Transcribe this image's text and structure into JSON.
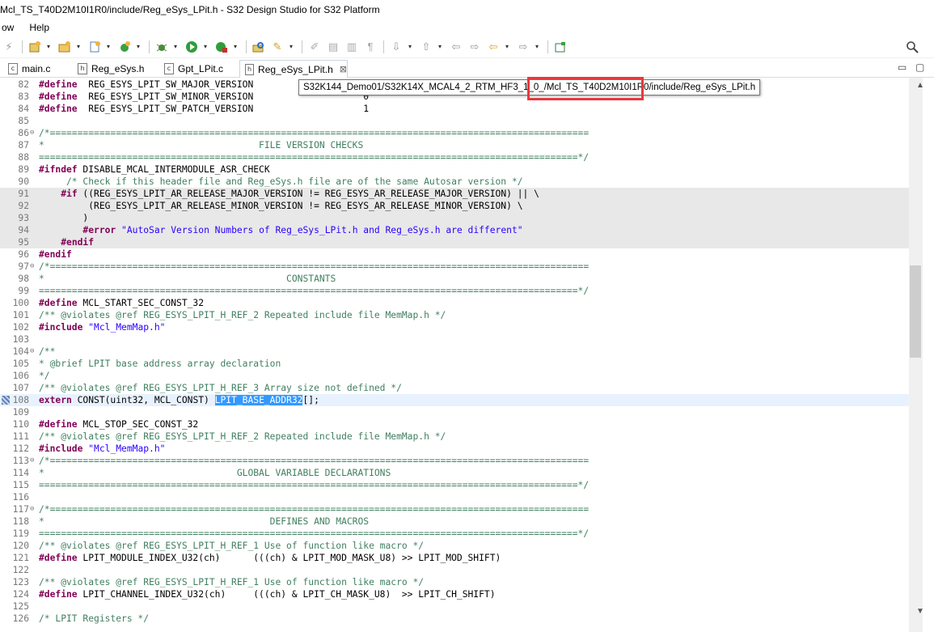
{
  "window": {
    "title": "Mcl_TS_T40D2M10I1R0/include/Reg_eSys_LPit.h - S32 Design Studio for S32 Platform"
  },
  "menu": [
    "ow",
    "Help"
  ],
  "tabs": [
    {
      "label": "main.c",
      "icon": "c-file-icon"
    },
    {
      "label": "Reg_eSys.h",
      "icon": "h-file-icon"
    },
    {
      "label": "Gpt_LPit.c",
      "icon": "c-file-icon"
    },
    {
      "label": "Reg_eSys_LPit.h",
      "icon": "h-file-icon",
      "active": true,
      "close": "⊠"
    }
  ],
  "window_controls": {
    "minimize": "▭",
    "maximize": "▢"
  },
  "tooltip": {
    "text": "S32K144_Demo01/S32K14X_MCAL4_2_RTM_HF3_1_0_/Mcl_TS_T40D2M10I1R0/include/Reg_eSys_LPit.h",
    "highlight_color": "#e8383d"
  },
  "colors": {
    "keyword": "#7f0055",
    "comment": "#3f7f5f",
    "string": "#2a00ff",
    "selection": "#3399ff"
  },
  "code": [
    {
      "n": "82",
      "parts": [
        [
          "kw",
          "#define"
        ],
        [
          "",
          "  REG_ESYS_LPIT_SW_MAJOR_VERSION"
        ]
      ]
    },
    {
      "n": "83",
      "parts": [
        [
          "kw",
          "#define"
        ],
        [
          "",
          "  REG_ESYS_LPIT_SW_MINOR_VERSION                    0"
        ]
      ]
    },
    {
      "n": "84",
      "parts": [
        [
          "kw",
          "#define"
        ],
        [
          "",
          "  REG_ESYS_LPIT_SW_PATCH_VERSION                    1"
        ]
      ]
    },
    {
      "n": "85",
      "parts": []
    },
    {
      "n": "86",
      "fold": "⊖",
      "parts": [
        [
          "cm",
          "/*=================================================================================================="
        ]
      ]
    },
    {
      "n": "87",
      "parts": [
        [
          "cm",
          "*                                       FILE VERSION CHECKS"
        ]
      ]
    },
    {
      "n": "88",
      "parts": [
        [
          "cm",
          "==================================================================================================*/"
        ]
      ]
    },
    {
      "n": "89",
      "parts": [
        [
          "kw",
          "#ifndef"
        ],
        [
          "",
          " DISABLE_MCAL_INTERMODULE_ASR_CHECK"
        ]
      ]
    },
    {
      "n": "90",
      "parts": [
        [
          "cm",
          "     /* Check if this header file and Reg_eSys.h file are of the same Autosar version */"
        ]
      ]
    },
    {
      "n": "91",
      "grey": true,
      "parts": [
        [
          "",
          "    "
        ],
        [
          "kw",
          "#if"
        ],
        [
          "",
          " ((REG_ESYS_LPIT_AR_RELEASE_MAJOR_VERSION != REG_ESYS_AR_RELEASE_MAJOR_VERSION) || \\"
        ]
      ]
    },
    {
      "n": "92",
      "grey": true,
      "parts": [
        [
          "",
          "         (REG_ESYS_LPIT_AR_RELEASE_MINOR_VERSION != REG_ESYS_AR_RELEASE_MINOR_VERSION) \\"
        ]
      ]
    },
    {
      "n": "93",
      "grey": true,
      "parts": [
        [
          "",
          "        )"
        ]
      ]
    },
    {
      "n": "94",
      "grey": true,
      "parts": [
        [
          "",
          "        "
        ],
        [
          "kw",
          "#error"
        ],
        [
          "",
          " "
        ],
        [
          "str",
          "\"AutoSar Version Numbers of Reg_eSys_LPit.h and Reg_eSys.h are different\""
        ]
      ]
    },
    {
      "n": "95",
      "grey": true,
      "parts": [
        [
          "",
          "    "
        ],
        [
          "kw",
          "#endif"
        ]
      ]
    },
    {
      "n": "96",
      "parts": [
        [
          "kw",
          "#endif"
        ]
      ]
    },
    {
      "n": "97",
      "fold": "⊖",
      "parts": [
        [
          "cm",
          "/*=================================================================================================="
        ]
      ]
    },
    {
      "n": "98",
      "parts": [
        [
          "cm",
          "*                                            CONSTANTS"
        ]
      ]
    },
    {
      "n": "99",
      "parts": [
        [
          "cm",
          "==================================================================================================*/"
        ]
      ]
    },
    {
      "n": "100",
      "parts": [
        [
          "kw",
          "#define"
        ],
        [
          "",
          " MCL_START_SEC_CONST_32"
        ]
      ]
    },
    {
      "n": "101",
      "parts": [
        [
          "cm",
          "/** @violates @ref REG_ESYS_LPIT_H_REF_2 Repeated include file MemMap.h */"
        ]
      ]
    },
    {
      "n": "102",
      "parts": [
        [
          "kw",
          "#include"
        ],
        [
          "",
          " "
        ],
        [
          "str",
          "\"Mcl_MemMap.h\""
        ]
      ]
    },
    {
      "n": "103",
      "parts": []
    },
    {
      "n": "104",
      "fold": "⊖",
      "parts": [
        [
          "cm",
          "/**"
        ]
      ]
    },
    {
      "n": "105",
      "parts": [
        [
          "cm",
          "* @brief LPIT base address array declaration"
        ]
      ]
    },
    {
      "n": "106",
      "parts": [
        [
          "cm",
          "*/"
        ]
      ]
    },
    {
      "n": "107",
      "parts": [
        [
          "cm",
          "/** @violates @ref REG_ESYS_LPIT_H_REF_3 Array size not defined */"
        ]
      ]
    },
    {
      "n": "108",
      "cur": true,
      "mark": true,
      "parts": [
        [
          "kw",
          "extern"
        ],
        [
          "",
          " CONST(uint32, MCL_CONST) "
        ],
        [
          "sel",
          "LPIT_BASE_ADDR32"
        ],
        [
          "",
          "[];"
        ]
      ]
    },
    {
      "n": "109",
      "parts": []
    },
    {
      "n": "110",
      "parts": [
        [
          "kw",
          "#define"
        ],
        [
          "",
          " MCL_STOP_SEC_CONST_32"
        ]
      ]
    },
    {
      "n": "111",
      "parts": [
        [
          "cm",
          "/** @violates @ref REG_ESYS_LPIT_H_REF_2 Repeated include file MemMap.h */"
        ]
      ]
    },
    {
      "n": "112",
      "parts": [
        [
          "kw",
          "#include"
        ],
        [
          "",
          " "
        ],
        [
          "str",
          "\"Mcl_MemMap.h\""
        ]
      ]
    },
    {
      "n": "113",
      "fold": "⊖",
      "parts": [
        [
          "cm",
          "/*=================================================================================================="
        ]
      ]
    },
    {
      "n": "114",
      "parts": [
        [
          "cm",
          "*                                   GLOBAL VARIABLE DECLARATIONS"
        ]
      ]
    },
    {
      "n": "115",
      "parts": [
        [
          "cm",
          "==================================================================================================*/"
        ]
      ]
    },
    {
      "n": "116",
      "parts": []
    },
    {
      "n": "117",
      "fold": "⊖",
      "parts": [
        [
          "cm",
          "/*=================================================================================================="
        ]
      ]
    },
    {
      "n": "118",
      "parts": [
        [
          "cm",
          "*                                         DEFINES AND MACROS"
        ]
      ]
    },
    {
      "n": "119",
      "parts": [
        [
          "cm",
          "==================================================================================================*/"
        ]
      ]
    },
    {
      "n": "120",
      "parts": [
        [
          "cm",
          "/** @violates @ref REG_ESYS_LPIT_H_REF_1 Use of function like macro */"
        ]
      ]
    },
    {
      "n": "121",
      "parts": [
        [
          "kw",
          "#define"
        ],
        [
          "",
          " LPIT_MODULE_INDEX_U32(ch)      (((ch) & LPIT_MOD_MASK_U8) >> LPIT_MOD_SHIFT)"
        ]
      ]
    },
    {
      "n": "122",
      "parts": []
    },
    {
      "n": "123",
      "parts": [
        [
          "cm",
          "/** @violates @ref REG_ESYS_LPIT_H_REF_1 Use of function like macro */"
        ]
      ]
    },
    {
      "n": "124",
      "parts": [
        [
          "kw",
          "#define"
        ],
        [
          "",
          " LPIT_CHANNEL_INDEX_U32(ch)     (((ch) & LPIT_CH_MASK_U8)  >> LPIT_CH_SHIFT)"
        ]
      ]
    },
    {
      "n": "125",
      "parts": []
    },
    {
      "n": "126",
      "parts": [
        [
          "cm",
          "/* LPIT Registers */"
        ]
      ]
    }
  ]
}
